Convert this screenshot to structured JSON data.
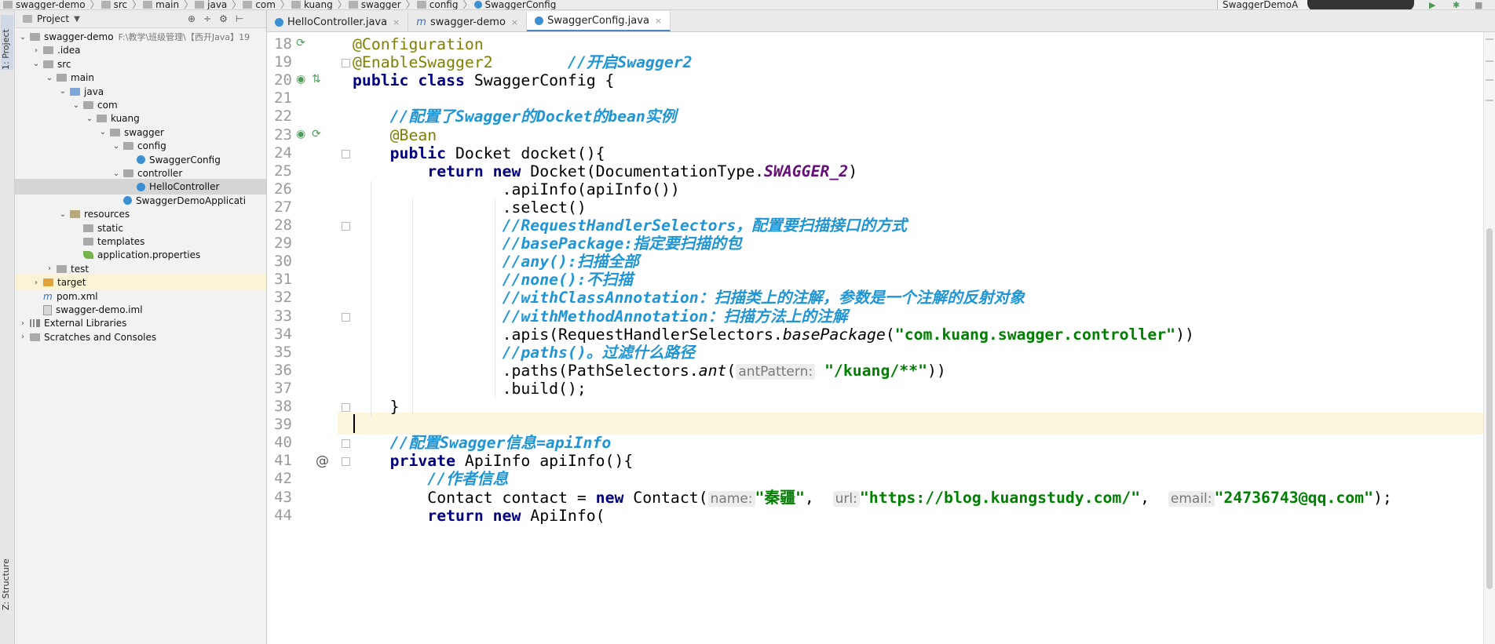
{
  "breadcrumb": [
    "swagger-demo",
    "src",
    "main",
    "java",
    "com",
    "kuang",
    "swagger",
    "config",
    "SwaggerConfig"
  ],
  "run_config": "SwaggerDemoA",
  "left_strip": {
    "project_tab": "1: Project",
    "structure_tab": "Z: Structure"
  },
  "project_panel": {
    "title": "Project",
    "tree": [
      {
        "label": "swagger-demo",
        "hint": "F:\\教学\\班级管理\\【西开Java】19",
        "icon": "folder",
        "depth": 0,
        "arrow": "down"
      },
      {
        "label": ".idea",
        "icon": "folder",
        "depth": 1,
        "arrow": "right"
      },
      {
        "label": "src",
        "icon": "folder",
        "depth": 1,
        "arrow": "down"
      },
      {
        "label": "main",
        "icon": "folder",
        "depth": 2,
        "arrow": "down"
      },
      {
        "label": "java",
        "icon": "source-folder",
        "depth": 3,
        "arrow": "down"
      },
      {
        "label": "com",
        "icon": "folder",
        "depth": 4,
        "arrow": "down"
      },
      {
        "label": "kuang",
        "icon": "folder",
        "depth": 5,
        "arrow": "down"
      },
      {
        "label": "swagger",
        "icon": "folder",
        "depth": 6,
        "arrow": "down"
      },
      {
        "label": "config",
        "icon": "folder",
        "depth": 7,
        "arrow": "down"
      },
      {
        "label": "SwaggerConfig",
        "icon": "class",
        "depth": 8,
        "arrow": ""
      },
      {
        "label": "controller",
        "icon": "folder",
        "depth": 7,
        "arrow": "down"
      },
      {
        "label": "HelloController",
        "icon": "class",
        "depth": 8,
        "arrow": "",
        "selected": true
      },
      {
        "label": "SwaggerDemoApplicati",
        "icon": "class",
        "depth": 7,
        "arrow": ""
      },
      {
        "label": "resources",
        "icon": "resources-folder",
        "depth": 3,
        "arrow": "down"
      },
      {
        "label": "static",
        "icon": "folder",
        "depth": 4,
        "arrow": ""
      },
      {
        "label": "templates",
        "icon": "folder",
        "depth": 4,
        "arrow": ""
      },
      {
        "label": "application.properties",
        "icon": "properties",
        "depth": 4,
        "arrow": ""
      },
      {
        "label": "test",
        "icon": "folder",
        "depth": 2,
        "arrow": "right"
      },
      {
        "label": "target",
        "icon": "target-folder",
        "depth": 1,
        "arrow": "right",
        "highlight": true
      },
      {
        "label": "pom.xml",
        "icon": "maven",
        "depth": 1,
        "arrow": ""
      },
      {
        "label": "swagger-demo.iml",
        "icon": "iml",
        "depth": 1,
        "arrow": ""
      },
      {
        "label": "External Libraries",
        "icon": "library",
        "depth": 0,
        "arrow": "right"
      },
      {
        "label": "Scratches and Consoles",
        "icon": "scratches",
        "depth": 0,
        "arrow": "right"
      }
    ]
  },
  "tabs": [
    {
      "label": "HelloController.java",
      "icon": "class"
    },
    {
      "label": "swagger-demo",
      "icon": "maven"
    },
    {
      "label": "SwaggerConfig.java",
      "icon": "class",
      "active": true
    }
  ],
  "editor": {
    "line_numbers": [
      "18",
      "19",
      "20",
      "21",
      "22",
      "23",
      "24",
      "25",
      "26",
      "27",
      "28",
      "29",
      "30",
      "31",
      "32",
      "33",
      "34",
      "35",
      "36",
      "37",
      "38",
      "39",
      "40",
      "41",
      "42",
      "43",
      "44"
    ],
    "lines": [
      [
        {
          "t": "@Configuration",
          "c": "an"
        }
      ],
      [
        {
          "t": "@EnableSwagger2",
          "c": "an"
        },
        {
          "t": "        ",
          "c": ""
        },
        {
          "t": "//开启Swagger2",
          "c": "cm"
        }
      ],
      [
        {
          "t": "public class ",
          "c": "kw"
        },
        {
          "t": "SwaggerConfig {",
          "c": ""
        }
      ],
      [],
      [
        {
          "t": "    ",
          "c": ""
        },
        {
          "t": "//配置了Swagger的Docket的bean实例",
          "c": "cm"
        }
      ],
      [
        {
          "t": "    ",
          "c": ""
        },
        {
          "t": "@Bean",
          "c": "an"
        }
      ],
      [
        {
          "t": "    ",
          "c": ""
        },
        {
          "t": "public ",
          "c": "kw"
        },
        {
          "t": "Docket docket(){",
          "c": ""
        }
      ],
      [
        {
          "t": "        ",
          "c": ""
        },
        {
          "t": "return new ",
          "c": "kw"
        },
        {
          "t": "Docket(DocumentationType.",
          "c": ""
        },
        {
          "t": "SWAGGER_2",
          "c": "cf"
        },
        {
          "t": ")",
          "c": ""
        }
      ],
      [
        {
          "t": "                ",
          "c": ""
        },
        {
          "t": ".apiInfo(apiInfo())",
          "c": ""
        }
      ],
      [
        {
          "t": "                ",
          "c": ""
        },
        {
          "t": ".select()",
          "c": ""
        }
      ],
      [
        {
          "t": "                ",
          "c": ""
        },
        {
          "t": "//RequestHandlerSelectors，配置要扫描接口的方式",
          "c": "cm"
        }
      ],
      [
        {
          "t": "                ",
          "c": ""
        },
        {
          "t": "//basePackage:指定要扫描的包",
          "c": "cm"
        }
      ],
      [
        {
          "t": "                ",
          "c": ""
        },
        {
          "t": "//any():扫描全部",
          "c": "cm"
        }
      ],
      [
        {
          "t": "                ",
          "c": ""
        },
        {
          "t": "//none():不扫描",
          "c": "cm"
        }
      ],
      [
        {
          "t": "                ",
          "c": ""
        },
        {
          "t": "//withClassAnnotation：扫描类上的注解，参数是一个注解的反射对象",
          "c": "cm"
        }
      ],
      [
        {
          "t": "                ",
          "c": ""
        },
        {
          "t": "//withMethodAnnotation：扫描方法上的注解",
          "c": "cm"
        }
      ],
      [
        {
          "t": "                ",
          "c": ""
        },
        {
          "t": ".apis(RequestHandlerSelectors.",
          "c": ""
        },
        {
          "t": "basePackage",
          "c": "it"
        },
        {
          "t": "(",
          "c": ""
        },
        {
          "t": "\"com.kuang.swagger.controller\"",
          "c": "st"
        },
        {
          "t": "))",
          "c": ""
        }
      ],
      [
        {
          "t": "                ",
          "c": ""
        },
        {
          "t": "//paths()。过滤什么路径",
          "c": "cm"
        }
      ],
      [
        {
          "t": "                ",
          "c": ""
        },
        {
          "t": ".paths(PathSelectors.",
          "c": ""
        },
        {
          "t": "ant",
          "c": "it"
        },
        {
          "t": "(",
          "c": ""
        },
        {
          "t": "antPattern:",
          "c": "ph"
        },
        {
          "t": " ",
          "c": ""
        },
        {
          "t": "\"/kuang/**\"",
          "c": "st"
        },
        {
          "t": "))",
          "c": ""
        }
      ],
      [
        {
          "t": "                ",
          "c": ""
        },
        {
          "t": ".build();",
          "c": ""
        }
      ],
      [
        {
          "t": "    }",
          "c": ""
        }
      ],
      [],
      [
        {
          "t": "    ",
          "c": ""
        },
        {
          "t": "//配置Swagger信息=apiInfo",
          "c": "cm"
        }
      ],
      [
        {
          "t": "    ",
          "c": ""
        },
        {
          "t": "private ",
          "c": "kw"
        },
        {
          "t": "ApiInfo apiInfo(){",
          "c": ""
        }
      ],
      [
        {
          "t": "        ",
          "c": ""
        },
        {
          "t": "//作者信息",
          "c": "cm"
        }
      ],
      [
        {
          "t": "        ",
          "c": ""
        },
        {
          "t": "Contact contact = ",
          "c": ""
        },
        {
          "t": "new ",
          "c": "kw"
        },
        {
          "t": "Contact(",
          "c": ""
        },
        {
          "t": "name:",
          "c": "ph"
        },
        {
          "t": "\"秦疆\"",
          "c": "st"
        },
        {
          "t": ",  ",
          "c": ""
        },
        {
          "t": "url:",
          "c": "ph"
        },
        {
          "t": "\"https://blog.kuangstudy.com/\"",
          "c": "st"
        },
        {
          "t": ",  ",
          "c": ""
        },
        {
          "t": "email:",
          "c": "ph"
        },
        {
          "t": "\"24736743@qq.com\"",
          "c": "st"
        },
        {
          "t": ");",
          "c": ""
        }
      ],
      [
        {
          "t": "        ",
          "c": ""
        },
        {
          "t": "return new ",
          "c": "kw"
        },
        {
          "t": "ApiInfo(",
          "c": ""
        }
      ]
    ],
    "current_line": "39"
  }
}
